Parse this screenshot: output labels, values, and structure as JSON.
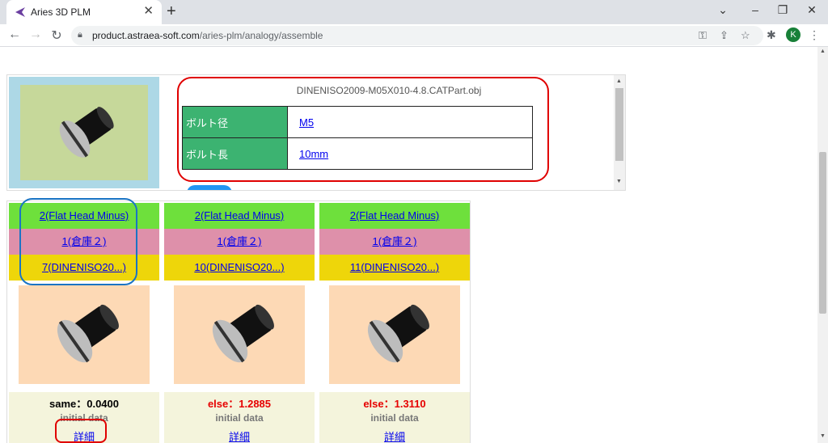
{
  "browser": {
    "tab_title": "Aries 3D PLM",
    "url_host": "product.astraea-soft.com",
    "url_path": "/aries-plm/analogy/assemble",
    "profile_initial": "K"
  },
  "detail": {
    "file_name": "DINENISO2009-M05X010-4.8.CATPart.obj",
    "params": [
      {
        "key": "ボルト径",
        "value": "M5"
      },
      {
        "key": "ボルト長",
        "value": "10mm"
      }
    ]
  },
  "cards": [
    {
      "shape": "2(Flat Head Minus)",
      "warehouse": "1(倉庫２)",
      "part": "7(DINENISO20...)",
      "score": "same：0.0400",
      "score_class": "same",
      "origin": "initial data",
      "detail_label": "詳細"
    },
    {
      "shape": "2(Flat Head Minus)",
      "warehouse": "1(倉庫２)",
      "part": "10(DINENISO20...)",
      "score": "else：1.2885",
      "score_class": "else",
      "origin": "initial data",
      "detail_label": "詳細"
    },
    {
      "shape": "2(Flat Head Minus)",
      "warehouse": "1(倉庫２)",
      "part": "11(DINENISO20...)",
      "score": "else：1.3110",
      "score_class": "else",
      "origin": "initial data",
      "detail_label": "詳細"
    }
  ],
  "colors": {
    "param_key_bg": "#3cb371",
    "row_green": "#6ee03c",
    "row_pink": "#de90aa",
    "row_yellow": "#eed60a",
    "highlight_red": "#e00000",
    "highlight_blue": "#1a74c4"
  }
}
